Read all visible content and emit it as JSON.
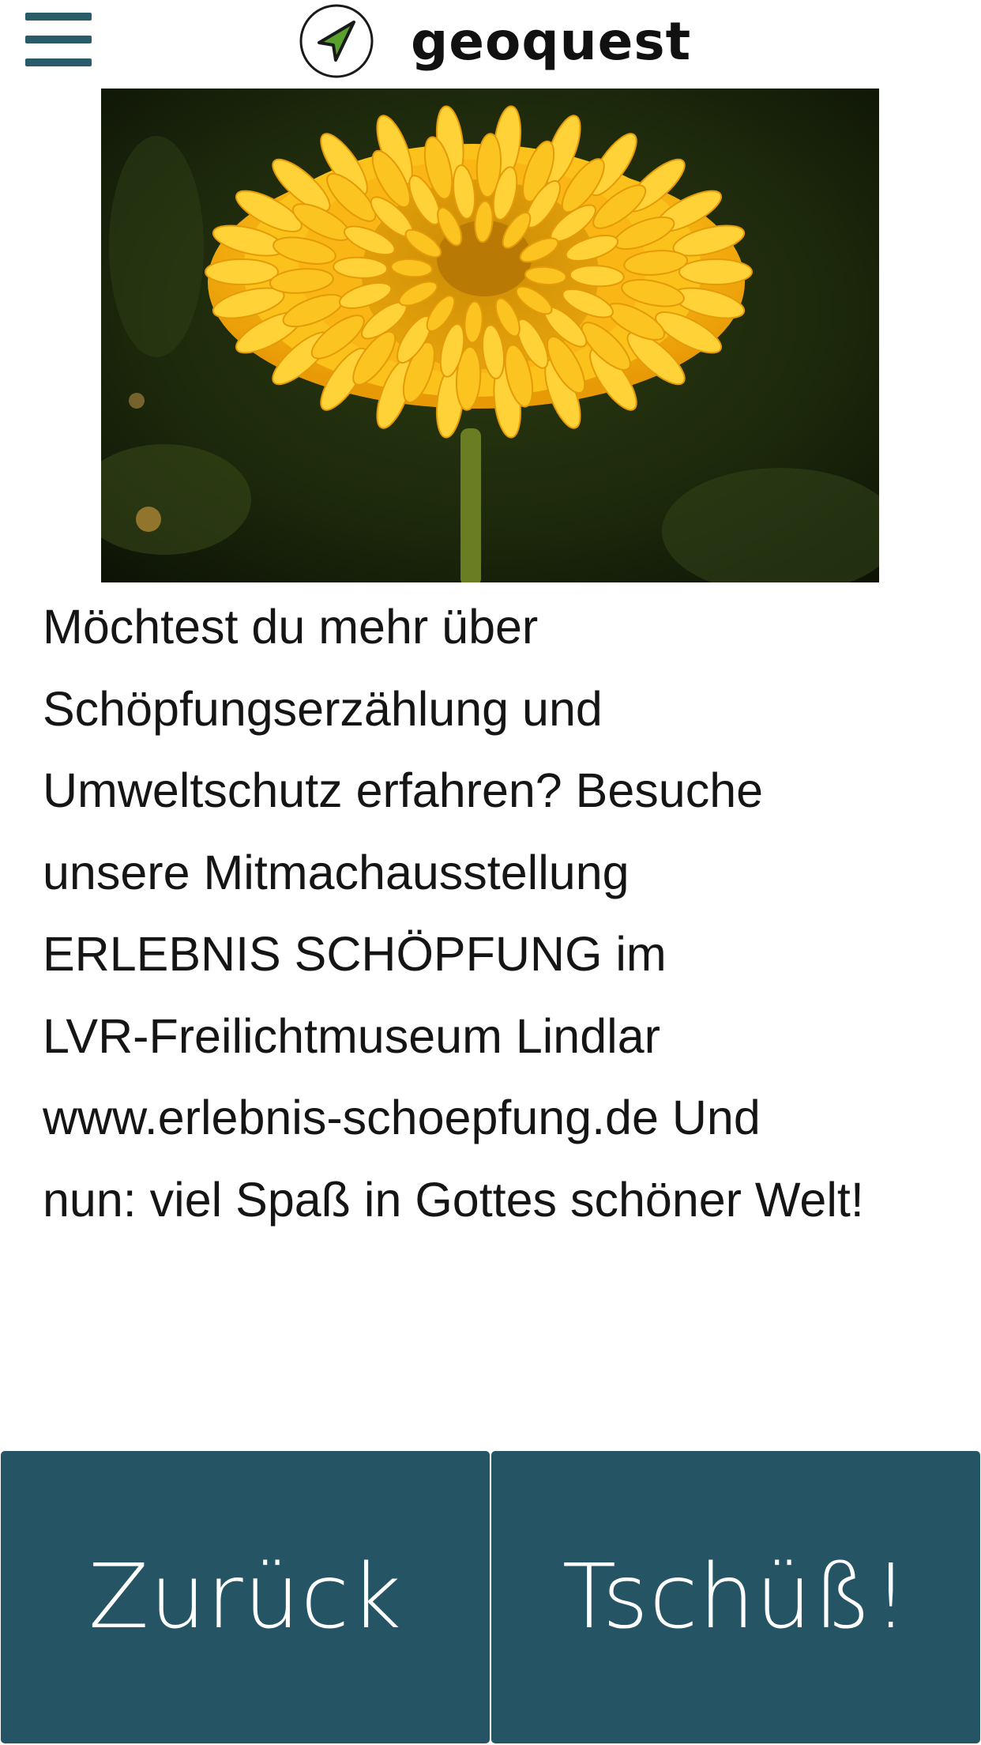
{
  "header": {
    "menu_icon": "hamburger-menu-icon",
    "logo_icon": "navigation-arrow-icon",
    "brand": "geoquest",
    "accent_color": "#2a5b69",
    "logo_arrow_color": "#5aa02c"
  },
  "main": {
    "image_subject": "yellow-flower-photo",
    "text": "Möchtest du mehr über\nSchöpfungserzählung und\nUmweltschutz erfahren? Besuche\nunsere Mitmachausstellung\nERLEBNIS SCHÖPFUNG im\nLVR-Freilichtmuseum Lindlar\nwww.erlebnis-schoepfung.de Und\nnun: viel Spaß in Gottes schöner Welt!"
  },
  "footer": {
    "back_label": "Zurück",
    "bye_label": "Tschüß!",
    "button_color": "#255564"
  }
}
